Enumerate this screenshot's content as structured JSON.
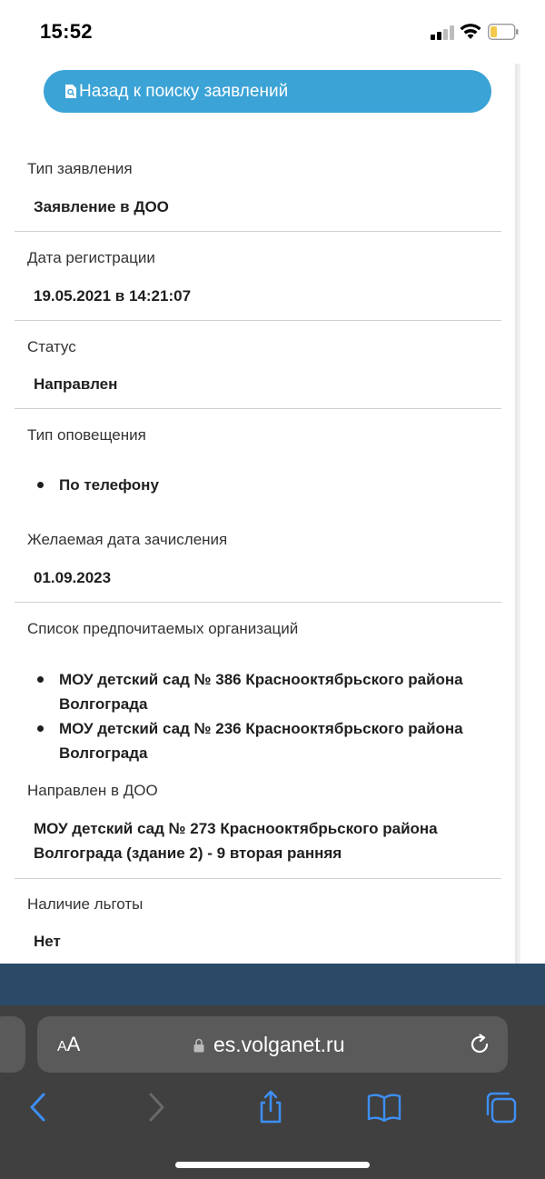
{
  "status_bar": {
    "time": "15:52"
  },
  "back_button": {
    "label": "Назад к поиску заявлений"
  },
  "fields": {
    "type": {
      "label": "Тип заявления",
      "value": "Заявление в ДОО"
    },
    "reg_date": {
      "label": "Дата регистрации",
      "value": "19.05.2021 в 14:21:07"
    },
    "status": {
      "label": "Статус",
      "value": "Направлен"
    },
    "notify": {
      "label": "Тип оповещения",
      "items": [
        "По телефону"
      ]
    },
    "enroll_date": {
      "label": "Желаемая дата зачисления",
      "value": "01.09.2023"
    },
    "orgs": {
      "label": "Список предпочитаемых организаций",
      "items": [
        {
          "line1": "МОУ детский сад № 386 Краснооктябрьского района",
          "line2": "Волгограда"
        },
        {
          "line1": "МОУ детский сад № 236 Краснооктябрьского района",
          "line2": "Волгограда"
        }
      ]
    },
    "directed": {
      "label": "Направлен в ДОО",
      "line1": "МОУ детский сад № 273 Краснооктябрьского района",
      "line2": "Волгограда (здание 2) - 9 вторая ранняя"
    },
    "benefit": {
      "label": "Наличие льготы",
      "value": "Нет"
    }
  },
  "browser": {
    "text_size_label_small": "A",
    "text_size_label_large": "A",
    "url": "es.volganet.ru"
  },
  "colors": {
    "accent": "#3ba3d6",
    "footer": "#2a4a68",
    "toolbar": "#404040",
    "toolbar_icon": "#3d8ff5"
  }
}
